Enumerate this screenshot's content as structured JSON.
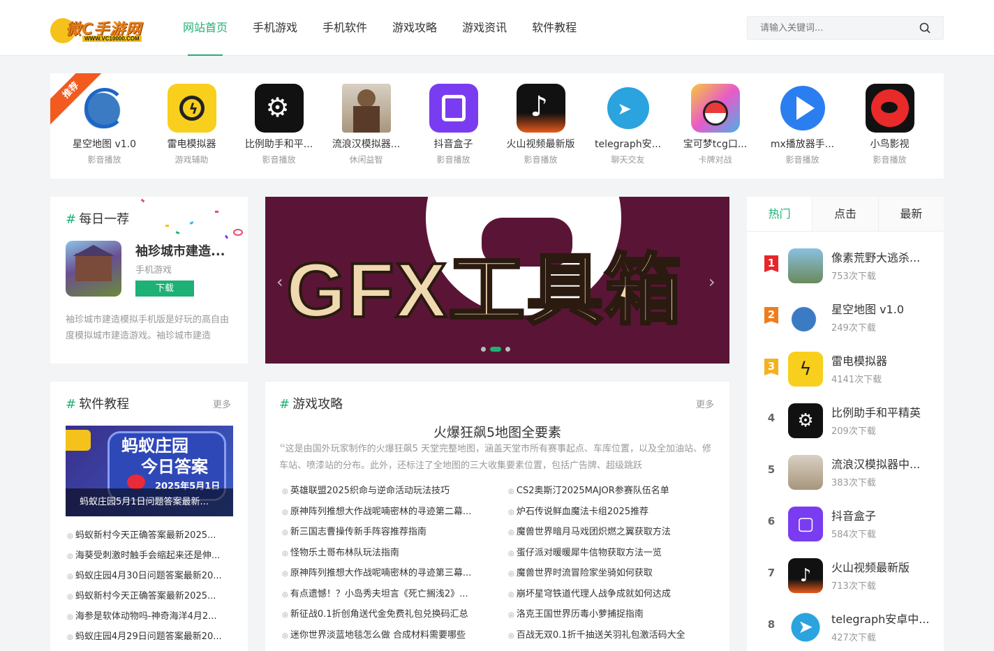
{
  "header": {
    "logo_text": "微C手游网",
    "logo_url": "WWW.VC10000.COM",
    "nav": [
      "网站首页",
      "手机游戏",
      "手机软件",
      "游戏攻略",
      "游戏资讯",
      "软件教程"
    ],
    "search_placeholder": "请输入关键词..."
  },
  "recommend": {
    "ribbon": "推荐",
    "items": [
      {
        "name": "星空地图 v1.0",
        "cat": "影音播放",
        "icon": "globe-icon"
      },
      {
        "name": "雷电模拟器",
        "cat": "游戏辅助",
        "icon": "thunder-icon"
      },
      {
        "name": "比例助手和平...",
        "cat": "影音播放",
        "icon": "tools-icon"
      },
      {
        "name": "流浪汉模拟器...",
        "cat": "休闲益智",
        "icon": "character-icon"
      },
      {
        "name": "抖音盒子",
        "cat": "影音播放",
        "icon": "box-icon"
      },
      {
        "name": "火山视频最新版",
        "cat": "影音播放",
        "icon": "tiktok-icon"
      },
      {
        "name": "telegraph安...",
        "cat": "聊天交友",
        "icon": "telegram-icon"
      },
      {
        "name": "宝可梦tcg口...",
        "cat": "卡牌对战",
        "icon": "pokeball-icon"
      },
      {
        "name": "mx播放器手...",
        "cat": "影音播放",
        "icon": "play-icon"
      },
      {
        "name": "小鸟影视",
        "cat": "影音播放",
        "icon": "bird-icon"
      }
    ]
  },
  "daily": {
    "title": "每日一荐",
    "name": "袖珍城市建造...",
    "cat": "手机游戏",
    "btn": "下载",
    "desc": "袖珍城市建造模拟手机版是好玩的高自由度模拟城市建造游戏。袖珍城市建造"
  },
  "banner": {
    "text": "GFX工具箱",
    "active_slide": 2,
    "slides": 3
  },
  "ranking": {
    "tabs": [
      "热门",
      "点击",
      "最新"
    ],
    "items": [
      {
        "rank": "1",
        "name": "像素荒野大逃杀...",
        "dl": "753次下载",
        "icon": "pixel-icon"
      },
      {
        "rank": "2",
        "name": "星空地图 v1.0",
        "dl": "249次下载",
        "icon": "globe-icon"
      },
      {
        "rank": "3",
        "name": "雷电模拟器",
        "dl": "4141次下载",
        "icon": "thunder-icon"
      },
      {
        "rank": "4",
        "name": "比例助手和平精英",
        "dl": "209次下载",
        "icon": "tools-icon"
      },
      {
        "rank": "5",
        "name": "流浪汉模拟器中...",
        "dl": "383次下载",
        "icon": "character-icon"
      },
      {
        "rank": "6",
        "name": "抖音盒子",
        "dl": "584次下载",
        "icon": "box-icon"
      },
      {
        "rank": "7",
        "name": "火山视频最新版",
        "dl": "713次下载",
        "icon": "tiktok-icon"
      },
      {
        "rank": "8",
        "name": "telegraph安卓中...",
        "dl": "427次下载",
        "icon": "telegram-icon"
      }
    ]
  },
  "software": {
    "title": "软件教程",
    "more": "更多",
    "img_title_1": "蚂蚁庄园",
    "img_title_2": "今日答案",
    "img_date": "2025年5月1日",
    "img_caption": "蚂蚁庄园5月1日问题答案最新...",
    "links": [
      "蚂蚁新村今天正确答案最新2025...",
      "海葵受刺激时触手会缩起来还是伸...",
      "蚂蚁庄园4月30日问题答案最新20...",
      "蚂蚁新村今天正确答案最新2025...",
      "海参是软体动物吗-神奇海洋4月2...",
      "蚂蚁庄园4月29日问题答案最新20..."
    ]
  },
  "strategy": {
    "title": "游戏攻略",
    "more": "更多",
    "head": "火爆狂飙5地图全要素",
    "desc": "这是由国外玩家制作的火爆狂飙5 天堂完整地图，涵盖天堂市所有赛事起点、车库位置，以及全加油站、修车站、喷漆站的分布。此外，还标注了全地图的三大收集要素位置，包括广告牌、超级跳跃",
    "left": [
      "英雄联盟2025织命与逆命活动玩法技巧",
      "原神阵列推想大作战呢喃密林的寻迹第二幕...",
      "新三国志曹操传新手阵容推荐指南",
      "怪物乐土哥布林队玩法指南",
      "原神阵列推想大作战呢喃密林的寻迹第三幕...",
      "有点遗憾！？小岛秀夫坦言《死亡搁浅2》...",
      "新征战0.1折创角送代金免费礼包兑换码汇总",
      "迷你世界淡蓝地毯怎么做 合成材料需要哪些"
    ],
    "right": [
      "CS2奥斯汀2025MAJOR参赛队伍名单",
      "炉石传说鲜血魔法卡组2025推荐",
      "魔兽世界暗月马戏团炽燃之翼获取方法",
      "蛋仔派对暖暖犀牛信物获取方法一览",
      "魔兽世界时流冒险家坐骑如何获取",
      "崩坏星穹铁道代理人战争成就如何达成",
      "洛克王国世界历毒小萝捕捉指南",
      "百战无双0.1折千抽送关羽礼包激活码大全"
    ]
  },
  "colors": {
    "accent": "#1fb075",
    "rank1": "#e8262a",
    "rank2": "#f07c1c",
    "rank3": "#f4b120"
  }
}
